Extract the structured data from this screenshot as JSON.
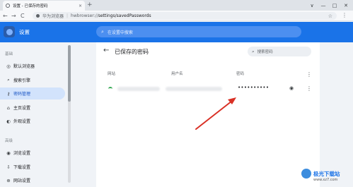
{
  "browser": {
    "tab_title": "设置 - 已保存的密码",
    "tab_close": "×",
    "new_tab": "+",
    "window_controls": [
      "∨",
      "—",
      "□",
      "✕"
    ],
    "nav": {
      "back": "←",
      "forward": "→",
      "reload": "C"
    },
    "address": {
      "source_label": "华为浏览器",
      "separator": "|",
      "url_prefix": "hwbrowser://",
      "url_path": "settings/savedPasswords"
    },
    "star": "☆",
    "menu": "⋮"
  },
  "header": {
    "title": "设置",
    "search_placeholder": "在设置中搜索",
    "search_icon": "search-icon"
  },
  "sidebar": {
    "section_basic": "基础",
    "section_advanced": "高级",
    "items": [
      {
        "label": "默认浏览器",
        "icon": "browser-icon",
        "glyph": "◎"
      },
      {
        "label": "搜索引擎",
        "icon": "search-icon",
        "glyph": "⌕"
      },
      {
        "label": "密码管理",
        "icon": "key-icon",
        "glyph": "⚷"
      },
      {
        "label": "主页设置",
        "icon": "home-icon",
        "glyph": "⌂"
      },
      {
        "label": "外观设置",
        "icon": "appearance-icon",
        "glyph": "◐"
      },
      {
        "label": "浏览设置",
        "icon": "eye-icon",
        "glyph": "◉"
      },
      {
        "label": "下载设置",
        "icon": "download-icon",
        "glyph": "⇩"
      },
      {
        "label": "网站设置",
        "icon": "globe-icon",
        "glyph": "⊕"
      }
    ],
    "active_index": 2
  },
  "main": {
    "back": "←",
    "title": "已保存的密码",
    "search_placeholder": "搜索密码",
    "columns": {
      "site": "网站",
      "username": "用户名",
      "password": "密码"
    },
    "row": {
      "password_mask": "••••••••••",
      "eye": "👁",
      "more": "⋮"
    },
    "header_more": "⋮"
  },
  "watermark": {
    "name": "极光下载站",
    "url": "www.xz7.com"
  },
  "colors": {
    "accent": "#1a73e8",
    "active_item_bg": "#d2e3fc",
    "annotation_arrow": "#d93025"
  }
}
